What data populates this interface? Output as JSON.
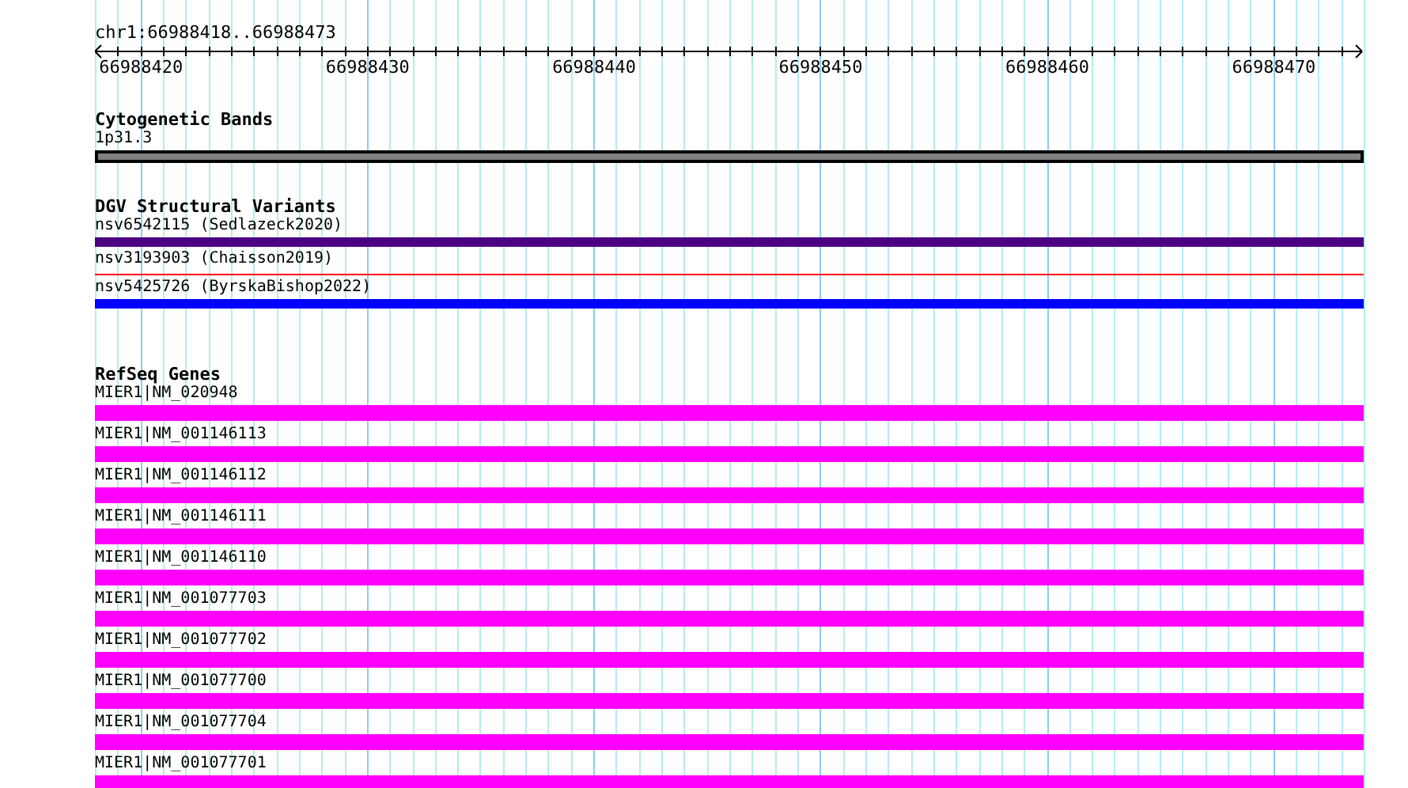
{
  "ruler": {
    "range": "chr1:66988418..66988473",
    "tick_labels": [
      "66988420",
      "66988430",
      "66988440",
      "66988450",
      "66988460",
      "66988470"
    ]
  },
  "tracks": [
    {
      "title": "Cytogenetic Bands",
      "features": [
        {
          "label": "1p31.3",
          "kind": "band",
          "color": "#808080"
        }
      ]
    },
    {
      "title": "DGV Structural Variants",
      "features": [
        {
          "label": "nsv6542115 (Sedlazeck2020)",
          "kind": "thick",
          "color": "#4b0082"
        },
        {
          "label": "nsv3193903 (Chaisson2019)",
          "kind": "thin",
          "color": "#ff0000"
        },
        {
          "label": "nsv5425726 (ByrskaBishop2022)",
          "kind": "thick",
          "color": "#0000ff"
        }
      ]
    },
    {
      "title": "RefSeq Genes",
      "features": [
        {
          "label": "MIER1|NM_020948",
          "kind": "gene",
          "color": "#ff00ff"
        },
        {
          "label": "MIER1|NM_001146113",
          "kind": "gene",
          "color": "#ff00ff"
        },
        {
          "label": "MIER1|NM_001146112",
          "kind": "gene",
          "color": "#ff00ff"
        },
        {
          "label": "MIER1|NM_001146111",
          "kind": "gene",
          "color": "#ff00ff"
        },
        {
          "label": "MIER1|NM_001146110",
          "kind": "gene",
          "color": "#ff00ff"
        },
        {
          "label": "MIER1|NM_001077703",
          "kind": "gene",
          "color": "#ff00ff"
        },
        {
          "label": "MIER1|NM_001077702",
          "kind": "gene",
          "color": "#ff00ff"
        },
        {
          "label": "MIER1|NM_001077700",
          "kind": "gene",
          "color": "#ff00ff"
        },
        {
          "label": "MIER1|NM_001077704",
          "kind": "gene",
          "color": "#ff00ff"
        },
        {
          "label": "MIER1|NM_001077701",
          "kind": "gene",
          "color": "#ff00ff"
        }
      ]
    }
  ]
}
